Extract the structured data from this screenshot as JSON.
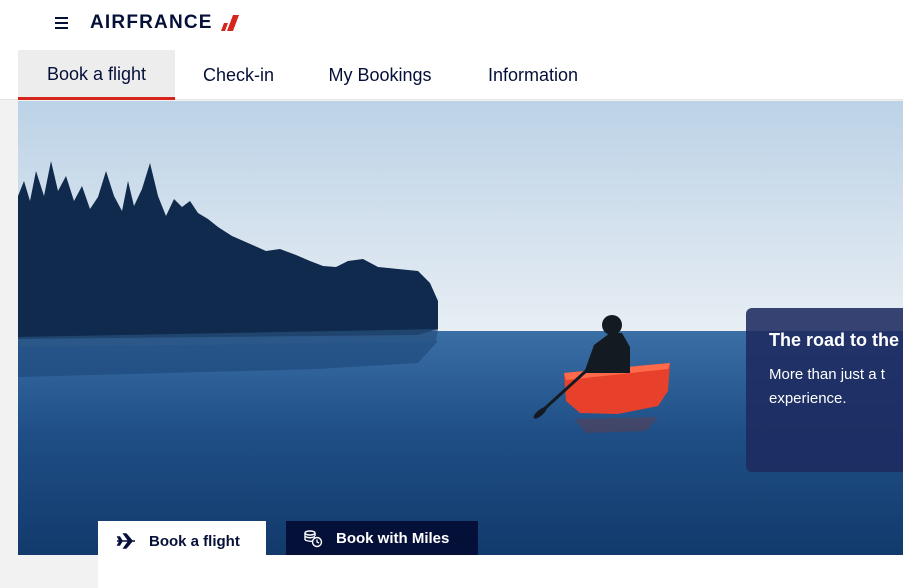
{
  "brand": {
    "name": "AIRFRANCE",
    "navy": "#051039",
    "red": "#d5251c"
  },
  "header": {
    "menu_icon": "hamburger-menu-icon"
  },
  "nav": {
    "tabs": [
      {
        "label": "Book a flight",
        "active": true
      },
      {
        "label": "Check-in",
        "active": false
      },
      {
        "label": "My Bookings",
        "active": false
      },
      {
        "label": "Information",
        "active": false
      }
    ]
  },
  "promo": {
    "title": "The road to the",
    "text_line1": "More than just a t",
    "text_line2": "experience."
  },
  "booking": {
    "tabs": [
      {
        "label": "Book a flight",
        "icon": "airplane-icon",
        "active": true
      },
      {
        "label": "Book with Miles",
        "icon": "miles-coins-icon",
        "active": false
      }
    ]
  }
}
